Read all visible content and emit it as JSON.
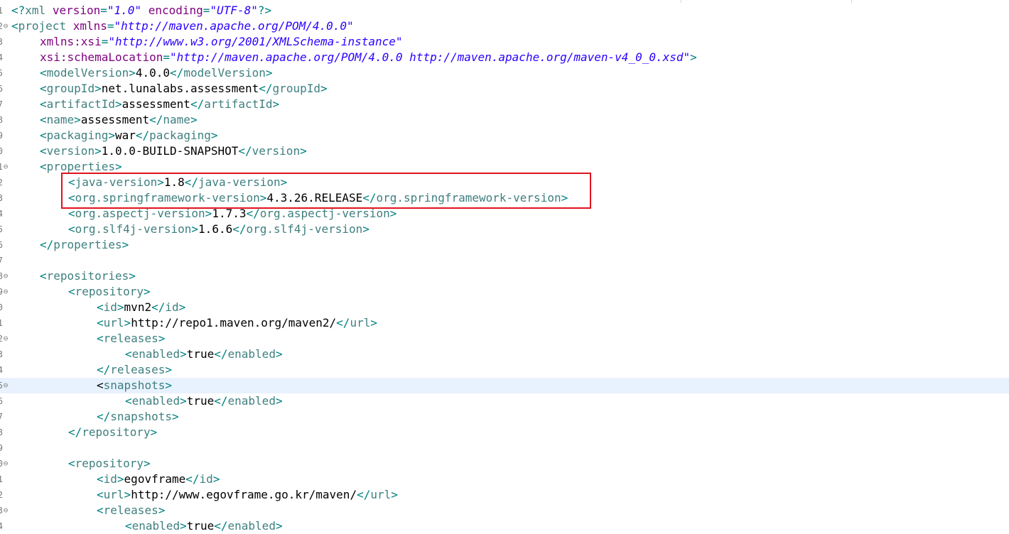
{
  "editor": {
    "lines": [
      {
        "num": "1",
        "fold": false,
        "indent": 0,
        "tokens": [
          [
            "b",
            "<?"
          ],
          [
            "n",
            "xml"
          ],
          [
            "x",
            " "
          ],
          [
            "a",
            "version"
          ],
          [
            "b",
            "="
          ],
          [
            "s",
            "\"1.0\""
          ],
          [
            "x",
            " "
          ],
          [
            "a",
            "encoding"
          ],
          [
            "b",
            "="
          ],
          [
            "s",
            "\"UTF-8\""
          ],
          [
            "b",
            "?>"
          ]
        ]
      },
      {
        "num": "2",
        "fold": true,
        "indent": 0,
        "tokens": [
          [
            "b",
            "<"
          ],
          [
            "n",
            "project"
          ],
          [
            "x",
            " "
          ],
          [
            "a",
            "xmlns"
          ],
          [
            "b",
            "="
          ],
          [
            "s",
            "\"http://maven.apache.org/POM/4.0.0\""
          ]
        ]
      },
      {
        "num": "3",
        "fold": false,
        "indent": 1,
        "tokens": [
          [
            "a",
            "xmlns:xsi"
          ],
          [
            "b",
            "="
          ],
          [
            "s",
            "\"http://www.w3.org/2001/XMLSchema-instance\""
          ]
        ]
      },
      {
        "num": "4",
        "fold": false,
        "indent": 1,
        "tokens": [
          [
            "a",
            "xsi:schemaLocation"
          ],
          [
            "b",
            "="
          ],
          [
            "s",
            "\"http://maven.apache.org/POM/4.0.0 http://maven.apache.org/maven-v4_0_0.xsd\""
          ],
          [
            "b",
            ">"
          ]
        ]
      },
      {
        "num": "5",
        "fold": false,
        "indent": 1,
        "tokens": [
          [
            "b",
            "<"
          ],
          [
            "n",
            "modelVersion"
          ],
          [
            "b",
            ">"
          ],
          [
            "x",
            "4.0.0"
          ],
          [
            "b",
            "</"
          ],
          [
            "n",
            "modelVersion"
          ],
          [
            "b",
            ">"
          ]
        ]
      },
      {
        "num": "6",
        "fold": false,
        "indent": 1,
        "tokens": [
          [
            "b",
            "<"
          ],
          [
            "n",
            "groupId"
          ],
          [
            "b",
            ">"
          ],
          [
            "x",
            "net.lunalabs.assessment"
          ],
          [
            "b",
            "</"
          ],
          [
            "n",
            "groupId"
          ],
          [
            "b",
            ">"
          ]
        ]
      },
      {
        "num": "7",
        "fold": false,
        "indent": 1,
        "tokens": [
          [
            "b",
            "<"
          ],
          [
            "n",
            "artifactId"
          ],
          [
            "b",
            ">"
          ],
          [
            "x",
            "assessment"
          ],
          [
            "b",
            "</"
          ],
          [
            "n",
            "artifactId"
          ],
          [
            "b",
            ">"
          ]
        ]
      },
      {
        "num": "8",
        "fold": false,
        "indent": 1,
        "tokens": [
          [
            "b",
            "<"
          ],
          [
            "n",
            "name"
          ],
          [
            "b",
            ">"
          ],
          [
            "x",
            "assessment"
          ],
          [
            "b",
            "</"
          ],
          [
            "n",
            "name"
          ],
          [
            "b",
            ">"
          ]
        ]
      },
      {
        "num": "9",
        "fold": false,
        "indent": 1,
        "tokens": [
          [
            "b",
            "<"
          ],
          [
            "n",
            "packaging"
          ],
          [
            "b",
            ">"
          ],
          [
            "x",
            "war"
          ],
          [
            "b",
            "</"
          ],
          [
            "n",
            "packaging"
          ],
          [
            "b",
            ">"
          ]
        ]
      },
      {
        "num": "0",
        "fold": false,
        "indent": 1,
        "tokens": [
          [
            "b",
            "<"
          ],
          [
            "n",
            "version"
          ],
          [
            "b",
            ">"
          ],
          [
            "x",
            "1.0.0-BUILD-SNAPSHOT"
          ],
          [
            "b",
            "</"
          ],
          [
            "n",
            "version"
          ],
          [
            "b",
            ">"
          ]
        ]
      },
      {
        "num": "1",
        "fold": true,
        "indent": 1,
        "tokens": [
          [
            "b",
            "<"
          ],
          [
            "n",
            "properties"
          ],
          [
            "b",
            ">"
          ]
        ]
      },
      {
        "num": "2",
        "fold": false,
        "indent": 2,
        "tokens": [
          [
            "b",
            "<"
          ],
          [
            "n",
            "java-version"
          ],
          [
            "b",
            ">"
          ],
          [
            "x",
            "1.8"
          ],
          [
            "b",
            "</"
          ],
          [
            "n",
            "java-version"
          ],
          [
            "b",
            ">"
          ]
        ]
      },
      {
        "num": "3",
        "fold": false,
        "indent": 2,
        "tokens": [
          [
            "b",
            "<"
          ],
          [
            "n",
            "org.springframework-version"
          ],
          [
            "b",
            ">"
          ],
          [
            "x",
            "4.3.26.RELEASE"
          ],
          [
            "b",
            "</"
          ],
          [
            "n",
            "org.springframework-version"
          ],
          [
            "b",
            ">"
          ]
        ]
      },
      {
        "num": "4",
        "fold": false,
        "indent": 2,
        "tokens": [
          [
            "b",
            "<"
          ],
          [
            "n",
            "org.aspectj-version"
          ],
          [
            "b",
            ">"
          ],
          [
            "x",
            "1.7.3"
          ],
          [
            "b",
            "</"
          ],
          [
            "n",
            "org.aspectj-version"
          ],
          [
            "b",
            ">"
          ]
        ]
      },
      {
        "num": "5",
        "fold": false,
        "indent": 2,
        "tokens": [
          [
            "b",
            "<"
          ],
          [
            "n",
            "org.slf4j-version"
          ],
          [
            "b",
            ">"
          ],
          [
            "x",
            "1.6.6"
          ],
          [
            "b",
            "</"
          ],
          [
            "n",
            "org.slf4j-version"
          ],
          [
            "b",
            ">"
          ]
        ]
      },
      {
        "num": "6",
        "fold": false,
        "indent": 1,
        "tokens": [
          [
            "b",
            "</"
          ],
          [
            "n",
            "properties"
          ],
          [
            "b",
            ">"
          ]
        ]
      },
      {
        "num": "7",
        "fold": false,
        "indent": 0,
        "tokens": []
      },
      {
        "num": "8",
        "fold": true,
        "indent": 1,
        "tokens": [
          [
            "b",
            "<"
          ],
          [
            "n",
            "repositories"
          ],
          [
            "b",
            ">"
          ]
        ]
      },
      {
        "num": "9",
        "fold": true,
        "indent": 2,
        "tokens": [
          [
            "b",
            "<"
          ],
          [
            "n",
            "repository"
          ],
          [
            "b",
            ">"
          ]
        ]
      },
      {
        "num": "0",
        "fold": false,
        "indent": 3,
        "tokens": [
          [
            "b",
            "<"
          ],
          [
            "n",
            "id"
          ],
          [
            "b",
            ">"
          ],
          [
            "x",
            "mvn2"
          ],
          [
            "b",
            "</"
          ],
          [
            "n",
            "id"
          ],
          [
            "b",
            ">"
          ]
        ]
      },
      {
        "num": "1",
        "fold": false,
        "indent": 3,
        "tokens": [
          [
            "b",
            "<"
          ],
          [
            "n",
            "url"
          ],
          [
            "b",
            ">"
          ],
          [
            "x",
            "http://repo1.maven.org/maven2/"
          ],
          [
            "b",
            "</"
          ],
          [
            "n",
            "url"
          ],
          [
            "b",
            ">"
          ]
        ]
      },
      {
        "num": "2",
        "fold": true,
        "indent": 3,
        "tokens": [
          [
            "b",
            "<"
          ],
          [
            "n",
            "releases"
          ],
          [
            "b",
            ">"
          ]
        ]
      },
      {
        "num": "3",
        "fold": false,
        "indent": 4,
        "tokens": [
          [
            "b",
            "<"
          ],
          [
            "n",
            "enabled"
          ],
          [
            "b",
            ">"
          ],
          [
            "x",
            "true"
          ],
          [
            "b",
            "</"
          ],
          [
            "n",
            "enabled"
          ],
          [
            "b",
            ">"
          ]
        ]
      },
      {
        "num": "4",
        "fold": false,
        "indent": 3,
        "tokens": [
          [
            "b",
            "</"
          ],
          [
            "n",
            "releases"
          ],
          [
            "b",
            ">"
          ]
        ]
      },
      {
        "num": "5",
        "fold": true,
        "indent": 3,
        "current": true,
        "tokens": [
          [
            "c",
            "<"
          ],
          [
            "n",
            "snapshots"
          ],
          [
            "b",
            ">"
          ]
        ]
      },
      {
        "num": "6",
        "fold": false,
        "indent": 4,
        "tokens": [
          [
            "b",
            "<"
          ],
          [
            "n",
            "enabled"
          ],
          [
            "b",
            ">"
          ],
          [
            "x",
            "true"
          ],
          [
            "b",
            "</"
          ],
          [
            "n",
            "enabled"
          ],
          [
            "b",
            ">"
          ]
        ]
      },
      {
        "num": "7",
        "fold": false,
        "indent": 3,
        "tokens": [
          [
            "b",
            "</"
          ],
          [
            "n",
            "snapshots"
          ],
          [
            "b",
            ">"
          ]
        ]
      },
      {
        "num": "8",
        "fold": false,
        "indent": 2,
        "tokens": [
          [
            "b",
            "</"
          ],
          [
            "n",
            "repository"
          ],
          [
            "b",
            ">"
          ]
        ]
      },
      {
        "num": "9",
        "fold": false,
        "indent": 0,
        "tokens": []
      },
      {
        "num": "0",
        "fold": true,
        "indent": 2,
        "tokens": [
          [
            "b",
            "<"
          ],
          [
            "n",
            "repository"
          ],
          [
            "b",
            ">"
          ]
        ]
      },
      {
        "num": "1",
        "fold": false,
        "indent": 3,
        "tokens": [
          [
            "b",
            "<"
          ],
          [
            "n",
            "id"
          ],
          [
            "b",
            ">"
          ],
          [
            "x",
            "egovframe"
          ],
          [
            "b",
            "</"
          ],
          [
            "n",
            "id"
          ],
          [
            "b",
            ">"
          ]
        ]
      },
      {
        "num": "2",
        "fold": false,
        "indent": 3,
        "tokens": [
          [
            "b",
            "<"
          ],
          [
            "n",
            "url"
          ],
          [
            "b",
            ">"
          ],
          [
            "x",
            "http://www.egovframe.go.kr/maven/"
          ],
          [
            "b",
            "</"
          ],
          [
            "n",
            "url"
          ],
          [
            "b",
            ">"
          ]
        ]
      },
      {
        "num": "3",
        "fold": true,
        "indent": 3,
        "tokens": [
          [
            "b",
            "<"
          ],
          [
            "n",
            "releases"
          ],
          [
            "b",
            ">"
          ]
        ]
      },
      {
        "num": "4",
        "fold": false,
        "indent": 4,
        "tokens": [
          [
            "b",
            "<"
          ],
          [
            "n",
            "enabled"
          ],
          [
            "b",
            ">"
          ],
          [
            "x",
            "true"
          ],
          [
            "b",
            "</"
          ],
          [
            "n",
            "enabled"
          ],
          [
            "b",
            ">"
          ]
        ]
      }
    ]
  },
  "icons": {
    "fold": "minus-circle-icon",
    "fold_glyph": "⊖"
  },
  "colors": {
    "bracket": "#008080",
    "tag_name": "#3f7f7f",
    "attribute": "#7f007f",
    "string": "#2a00ff",
    "text": "#000000",
    "current_line": "#e8f2fe",
    "highlight_box": "#e0131d"
  }
}
